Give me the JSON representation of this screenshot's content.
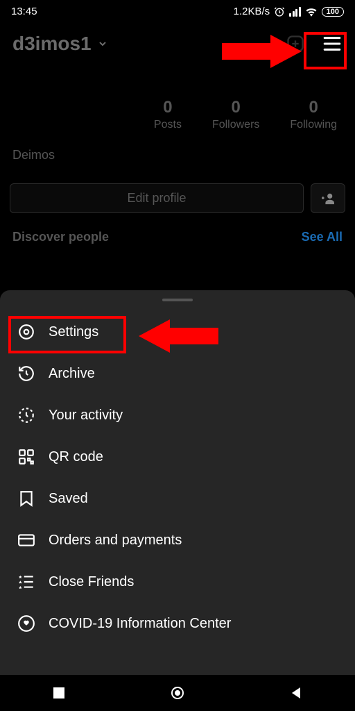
{
  "status": {
    "time": "13:45",
    "speed": "1.2KB/s",
    "battery": "100"
  },
  "profile": {
    "username": "d3imos1",
    "display_name": "Deimos",
    "stats": [
      {
        "value": "0",
        "label": "Posts"
      },
      {
        "value": "0",
        "label": "Followers"
      },
      {
        "value": "0",
        "label": "Following"
      }
    ],
    "edit_button": "Edit profile",
    "discover_label": "Discover people",
    "see_all": "See All"
  },
  "menu": {
    "items": [
      {
        "label": "Settings"
      },
      {
        "label": "Archive"
      },
      {
        "label": "Your activity"
      },
      {
        "label": "QR code"
      },
      {
        "label": "Saved"
      },
      {
        "label": "Orders and payments"
      },
      {
        "label": "Close Friends"
      },
      {
        "label": "COVID-19 Information Center"
      }
    ]
  },
  "annotations": {
    "hamburger_highlight": true,
    "settings_highlight": true
  }
}
